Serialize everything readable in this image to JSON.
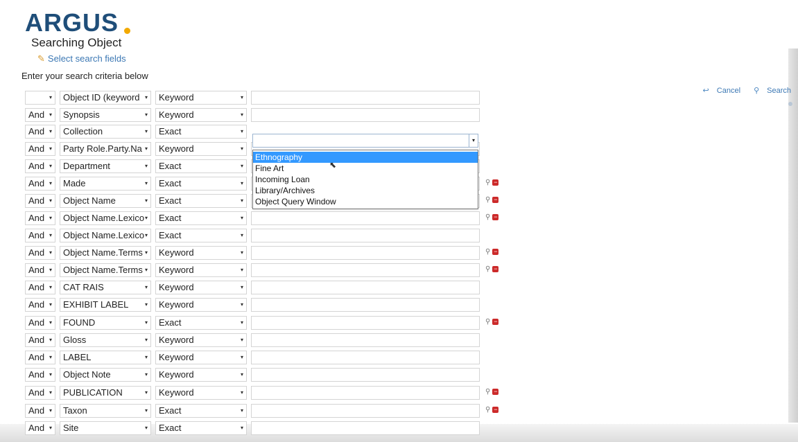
{
  "header": {
    "logo": "ARGUS",
    "title": "Searching Object",
    "select_fields": "Select search fields",
    "instructions": "Enter your search criteria below"
  },
  "actions": {
    "cancel": "Cancel",
    "search": "Search"
  },
  "colors": {
    "brand": "#1f4e79",
    "accent_dot": "#f2a900",
    "link": "#3c78b4",
    "highlight": "#3399ff",
    "remove": "#cc2a2a"
  },
  "rows": [
    {
      "conj": "",
      "field": "Object ID (keyword",
      "op": "Keyword",
      "icons": false
    },
    {
      "conj": "And",
      "field": "Synopsis",
      "op": "Keyword",
      "icons": false
    },
    {
      "conj": "And",
      "field": "Collection",
      "op": "Exact",
      "icons": false
    },
    {
      "conj": "And",
      "field": "Party Role.Party.Na",
      "op": "Keyword",
      "icons": false
    },
    {
      "conj": "And",
      "field": "Department",
      "op": "Exact",
      "icons": false
    },
    {
      "conj": "And",
      "field": "Made",
      "op": "Exact",
      "icons": true
    },
    {
      "conj": "And",
      "field": "Object Name",
      "op": "Exact",
      "icons": true
    },
    {
      "conj": "And",
      "field": "Object Name.Lexico",
      "op": "Exact",
      "icons": true
    },
    {
      "conj": "And",
      "field": "Object Name.Lexico",
      "op": "Exact",
      "icons": false
    },
    {
      "conj": "And",
      "field": "Object Name.Terms",
      "op": "Keyword",
      "icons": true
    },
    {
      "conj": "And",
      "field": "Object Name.Terms",
      "op": "Keyword",
      "icons": true
    },
    {
      "conj": "And",
      "field": "CAT RAIS",
      "op": "Keyword",
      "icons": false
    },
    {
      "conj": "And",
      "field": "EXHIBIT LABEL",
      "op": "Keyword",
      "icons": false
    },
    {
      "conj": "And",
      "field": "FOUND",
      "op": "Exact",
      "icons": true
    },
    {
      "conj": "And",
      "field": "Gloss",
      "op": "Keyword",
      "icons": false
    },
    {
      "conj": "And",
      "field": "LABEL",
      "op": "Keyword",
      "icons": false
    },
    {
      "conj": "And",
      "field": "Object Note",
      "op": "Keyword",
      "icons": false
    },
    {
      "conj": "And",
      "field": "PUBLICATION",
      "op": "Keyword",
      "icons": true
    },
    {
      "conj": "And",
      "field": "Taxon",
      "op": "Exact",
      "icons": true
    },
    {
      "conj": "And",
      "field": "Site",
      "op": "Exact",
      "icons": false
    }
  ],
  "collection_dropdown": {
    "options": [
      "Ethnography",
      "Fine Art",
      "Incoming Loan",
      "Library/Archives",
      "Object Query Window"
    ],
    "highlighted": "Ethnography"
  },
  "icons": {
    "search_row": "magnifier-icon",
    "remove_row": "minus-icon",
    "edit": "pencil-icon"
  }
}
